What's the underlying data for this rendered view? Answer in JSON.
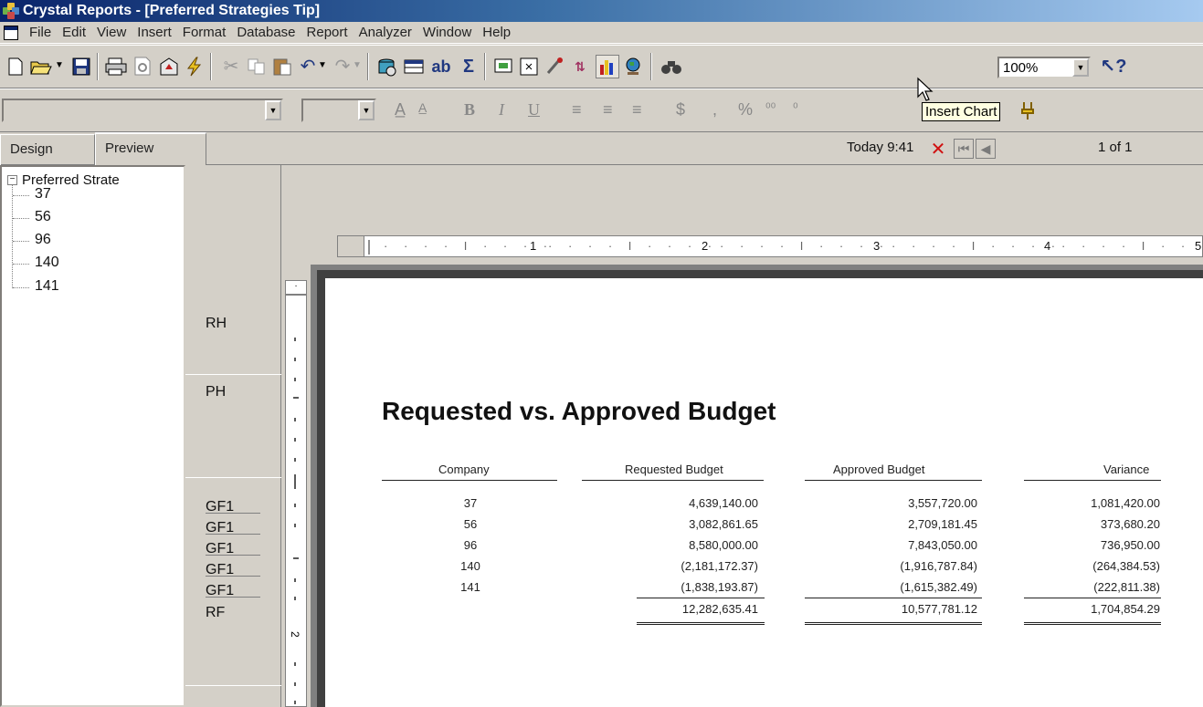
{
  "window": {
    "title": "Crystal Reports - [Preferred Strategies Tip]"
  },
  "menu": [
    "File",
    "Edit",
    "View",
    "Insert",
    "Format",
    "Database",
    "Report",
    "Analyzer",
    "Window",
    "Help"
  ],
  "toolbar": {
    "zoom": "100%",
    "tooltip": "Insert Chart",
    "icons": [
      "new-icon",
      "open-icon",
      "save-icon",
      "print-icon",
      "print-preview-icon",
      "export-icon",
      "refresh-icon",
      "cut-icon",
      "copy-icon",
      "paste-icon",
      "undo-icon",
      "redo-icon",
      "database-expert-icon",
      "insert-group-icon",
      "text-object-icon",
      "summary-icon",
      "insert-subreport-icon",
      "cross-tab-icon",
      "formula-icon",
      "sort-icon",
      "insert-chart-icon",
      "insert-map-icon",
      "find-icon",
      "help-icon"
    ]
  },
  "tabs": {
    "design": "Design",
    "preview": "Preview"
  },
  "nav": {
    "today": "Today  9:41",
    "page": "1 of 1"
  },
  "tree": {
    "root": "Preferred Strate",
    "items": [
      "37",
      "56",
      "96",
      "140",
      "141"
    ]
  },
  "sections": [
    "RH",
    "PH",
    "GF1",
    "GF1",
    "GF1",
    "GF1",
    "GF1",
    "RF"
  ],
  "ruler": {
    "marks": [
      "1",
      "2",
      "3",
      "4",
      "5"
    ]
  },
  "report": {
    "title": "Requested vs. Approved Budget",
    "headers": {
      "company": "Company",
      "requested": "Requested Budget",
      "approved": "Approved Budget",
      "variance": "Variance"
    },
    "rows": [
      {
        "company": "37",
        "requested": "4,639,140.00",
        "approved": "3,557,720.00",
        "variance": "1,081,420.00"
      },
      {
        "company": "56",
        "requested": "3,082,861.65",
        "approved": "2,709,181.45",
        "variance": "373,680.20"
      },
      {
        "company": "96",
        "requested": "8,580,000.00",
        "approved": "7,843,050.00",
        "variance": "736,950.00"
      },
      {
        "company": "140",
        "requested": "(2,181,172.37)",
        "approved": "(1,916,787.84)",
        "variance": "(264,384.53)"
      },
      {
        "company": "141",
        "requested": "(1,838,193.87)",
        "approved": "(1,615,382.49)",
        "variance": "(222,811.38)"
      }
    ],
    "totals": {
      "requested": "12,282,635.41",
      "approved": "10,577,781.12",
      "variance": "1,704,854.29"
    }
  }
}
